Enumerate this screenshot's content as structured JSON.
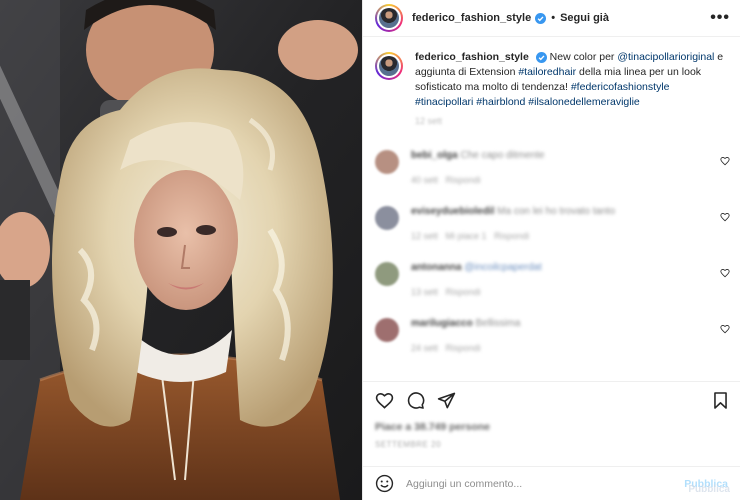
{
  "header": {
    "username": "federico_fashion_style",
    "separator": "•",
    "follow_label": "Segui già",
    "more_label": "•••"
  },
  "caption": {
    "username": "federico_fashion_style",
    "text_1": "New color per ",
    "mention": "@tinacipollarioriginal",
    "text_2": " e aggiunta di Extension ",
    "tag_1": "#tailoredhair",
    "text_3": " della mia linea per un look sofisticato ma molto di tendenza! ",
    "tag_2": "#federicofashionstyle",
    "tag_3": "#tinacipollari",
    "tag_4": "#hairblond",
    "tag_5": "#ilsalonedellemeraviglie",
    "time": "12 sett"
  },
  "comments": [
    {
      "user": "bebi_olga",
      "text": "Che capo ditmente",
      "meta_time": "40 sett",
      "meta_reply": "Rispondi",
      "color": "#b79082"
    },
    {
      "user": "eviseyduebioledil",
      "text": "Ma con lei ho trovato tanto",
      "meta_time": "12 sett",
      "meta_likes": "Mi piace 1",
      "meta_reply": "Rispondi",
      "color": "#8b8f9e"
    },
    {
      "user": "antonanna",
      "text": "@incoilcpaperdat",
      "meta_time": "13 sett",
      "meta_reply": "Rispondi",
      "color": "#8f9a7e"
    },
    {
      "user": "marilugiacco",
      "text": "Bellissima",
      "meta_time": "24 sett",
      "meta_reply": "Rispondi",
      "color": "#9e6f6f"
    }
  ],
  "likes": "Piace a 38.749 persone",
  "date": "SETTEMBRE 20",
  "add_comment": {
    "placeholder": "Aggiungi un commento...",
    "publish_label": "Pubblica"
  },
  "watermark": "Pubblica",
  "icons": {
    "verified": "verified-badge-icon",
    "like": "heart-icon",
    "comment": "comment-icon",
    "share": "share-icon",
    "save": "bookmark-icon",
    "emoji": "emoji-icon",
    "more": "more-icon"
  },
  "colors": {
    "verified_blue": "#3897f0",
    "link_blue": "#00376b",
    "publish_disabled": "#b2dffc"
  }
}
